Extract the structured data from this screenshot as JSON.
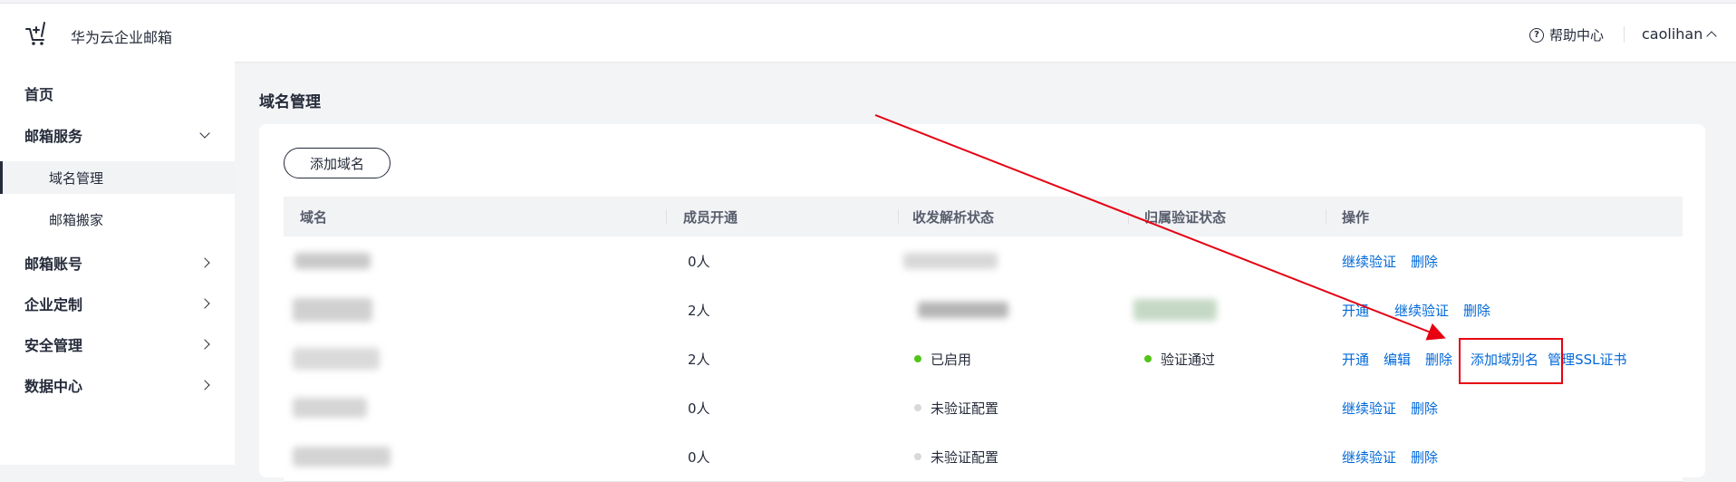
{
  "header": {
    "brand": "华为云企业邮箱",
    "help_label": "帮助中心",
    "username": "caolihan",
    "logo_icon": "cart-sparkle-icon"
  },
  "sidebar": {
    "items": [
      {
        "label": "首页"
      },
      {
        "label": "邮箱服务"
      },
      {
        "label": "域名管理"
      },
      {
        "label": "邮箱搬家"
      },
      {
        "label": "邮箱账号"
      },
      {
        "label": "企业定制"
      },
      {
        "label": "安全管理"
      },
      {
        "label": "数据中心"
      }
    ]
  },
  "main": {
    "page_title": "域名管理",
    "add_button": "添加域名",
    "table": {
      "headers": [
        "域名",
        "成员开通",
        "收发解析状态",
        "归属验证状态",
        "操作"
      ],
      "rows": [
        {
          "members": "0人",
          "parse_status": "",
          "verify_status": "",
          "actions": [
            "继续验证",
            "删除"
          ]
        },
        {
          "members": "2人",
          "parse_status": "",
          "verify_status": "",
          "actions": [
            "开通",
            "继续验证",
            "删除"
          ]
        },
        {
          "members": "2人",
          "parse_status": "已启用",
          "verify_status": "验证通过",
          "actions": [
            "开通",
            "编辑",
            "删除",
            "添加域别名",
            "管理SSL证书"
          ]
        },
        {
          "members": "0人",
          "parse_status": "未验证配置",
          "verify_status": "",
          "actions": [
            "继续验证",
            "删除"
          ]
        },
        {
          "members": "0人",
          "parse_status": "未验证配置",
          "verify_status": "",
          "actions": [
            "继续验证",
            "删除"
          ]
        }
      ]
    }
  },
  "colors": {
    "accent_link": "#0068d9",
    "status_green": "#52c41a",
    "annotation_red": "#e60012"
  }
}
